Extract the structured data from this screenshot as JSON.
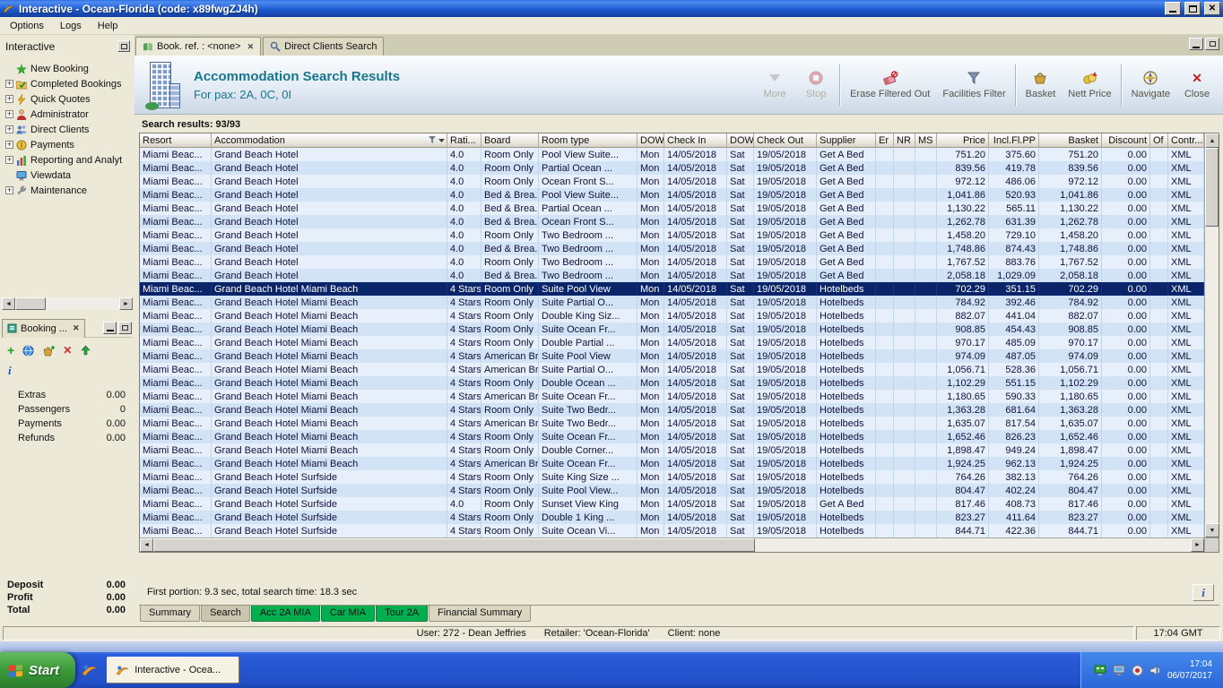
{
  "window": {
    "title": "Interactive - Ocean-Florida (code: x89fwgZJ4h)",
    "menu": [
      "Options",
      "Logs",
      "Help"
    ]
  },
  "sidebar": {
    "title": "Interactive",
    "items": [
      {
        "label": "New Booking",
        "expand": false
      },
      {
        "label": "Completed Bookings",
        "expand": true
      },
      {
        "label": "Quick Quotes",
        "expand": true
      },
      {
        "label": "Administrator",
        "expand": true
      },
      {
        "label": "Direct Clients",
        "expand": true
      },
      {
        "label": "Payments",
        "expand": true
      },
      {
        "label": "Reporting and Analyt",
        "expand": true
      },
      {
        "label": "Viewdata",
        "expand": false
      },
      {
        "label": "Maintenance",
        "expand": true
      }
    ]
  },
  "booking_panel": {
    "title": "Booking ...",
    "fields": [
      {
        "label": "Extras",
        "value": "0.00"
      },
      {
        "label": "Passengers",
        "value": "0"
      },
      {
        "label": "Payments",
        "value": "0.00"
      },
      {
        "label": "Refunds",
        "value": "0.00"
      }
    ],
    "totals": [
      {
        "label": "Deposit",
        "value": "0.00"
      },
      {
        "label": "Profit",
        "value": "0.00"
      },
      {
        "label": "Total",
        "value": "0.00"
      }
    ]
  },
  "tabs": [
    {
      "label": "Book. ref. : <none>"
    },
    {
      "label": "Direct Clients Search"
    }
  ],
  "header": {
    "title": "Accommodation Search Results",
    "subtitle": "For pax: 2A, 0C, 0I"
  },
  "toolbar": [
    {
      "label": "More",
      "disabled": true
    },
    {
      "label": "Stop",
      "disabled": true
    },
    {
      "label": "Erase Filtered Out"
    },
    {
      "label": "Facilities Filter"
    },
    {
      "label": "Basket"
    },
    {
      "label": "Nett Price"
    },
    {
      "label": "Navigate"
    },
    {
      "label": "Close"
    }
  ],
  "results": {
    "label": "Search results: 93/93",
    "columns": [
      "Resort",
      "Accommodation",
      "Rati...",
      "Board",
      "Room type",
      "DOW",
      "Check In",
      "DOW",
      "Check Out",
      "Supplier",
      "Er",
      "NR",
      "MS",
      "Price",
      "Incl.Fl.PP",
      "Basket",
      "Discount",
      "Of",
      "Contr..."
    ],
    "rows": [
      {
        "resort": "Miami Beac...",
        "acc": "Grand Beach Hotel",
        "rating": "4.0",
        "board": "Room Only",
        "room": "Pool View Suite...",
        "dow1": "Mon",
        "checkin": "14/05/2018",
        "dow2": "Sat",
        "checkout": "19/05/2018",
        "supplier": "Get A Bed",
        "price": "751.20",
        "incl": "375.60",
        "basket": "751.20",
        "discount": "0.00",
        "contract": "XML"
      },
      {
        "resort": "Miami Beac...",
        "acc": "Grand Beach Hotel",
        "rating": "4.0",
        "board": "Room Only",
        "room": "Partial Ocean ...",
        "dow1": "Mon",
        "checkin": "14/05/2018",
        "dow2": "Sat",
        "checkout": "19/05/2018",
        "supplier": "Get A Bed",
        "price": "839.56",
        "incl": "419.78",
        "basket": "839.56",
        "discount": "0.00",
        "contract": "XML"
      },
      {
        "resort": "Miami Beac...",
        "acc": "Grand Beach Hotel",
        "rating": "4.0",
        "board": "Room Only",
        "room": "Ocean Front S...",
        "dow1": "Mon",
        "checkin": "14/05/2018",
        "dow2": "Sat",
        "checkout": "19/05/2018",
        "supplier": "Get A Bed",
        "price": "972.12",
        "incl": "486.06",
        "basket": "972.12",
        "discount": "0.00",
        "contract": "XML"
      },
      {
        "resort": "Miami Beac...",
        "acc": "Grand Beach Hotel",
        "rating": "4.0",
        "board": "Bed & Brea...",
        "room": "Pool View Suite...",
        "dow1": "Mon",
        "checkin": "14/05/2018",
        "dow2": "Sat",
        "checkout": "19/05/2018",
        "supplier": "Get A Bed",
        "price": "1,041.86",
        "incl": "520.93",
        "basket": "1,041.86",
        "discount": "0.00",
        "contract": "XML"
      },
      {
        "resort": "Miami Beac...",
        "acc": "Grand Beach Hotel",
        "rating": "4.0",
        "board": "Bed & Brea...",
        "room": "Partial Ocean ...",
        "dow1": "Mon",
        "checkin": "14/05/2018",
        "dow2": "Sat",
        "checkout": "19/05/2018",
        "supplier": "Get A Bed",
        "price": "1,130.22",
        "incl": "565.11",
        "basket": "1,130.22",
        "discount": "0.00",
        "contract": "XML"
      },
      {
        "resort": "Miami Beac...",
        "acc": "Grand Beach Hotel",
        "rating": "4.0",
        "board": "Bed & Brea...",
        "room": "Ocean Front S...",
        "dow1": "Mon",
        "checkin": "14/05/2018",
        "dow2": "Sat",
        "checkout": "19/05/2018",
        "supplier": "Get A Bed",
        "price": "1,262.78",
        "incl": "631.39",
        "basket": "1,262.78",
        "discount": "0.00",
        "contract": "XML"
      },
      {
        "resort": "Miami Beac...",
        "acc": "Grand Beach Hotel",
        "rating": "4.0",
        "board": "Room Only",
        "room": "Two Bedroom ...",
        "dow1": "Mon",
        "checkin": "14/05/2018",
        "dow2": "Sat",
        "checkout": "19/05/2018",
        "supplier": "Get A Bed",
        "price": "1,458.20",
        "incl": "729.10",
        "basket": "1,458.20",
        "discount": "0.00",
        "contract": "XML"
      },
      {
        "resort": "Miami Beac...",
        "acc": "Grand Beach Hotel",
        "rating": "4.0",
        "board": "Bed & Brea...",
        "room": "Two Bedroom ...",
        "dow1": "Mon",
        "checkin": "14/05/2018",
        "dow2": "Sat",
        "checkout": "19/05/2018",
        "supplier": "Get A Bed",
        "price": "1,748.86",
        "incl": "874.43",
        "basket": "1,748.86",
        "discount": "0.00",
        "contract": "XML"
      },
      {
        "resort": "Miami Beac...",
        "acc": "Grand Beach Hotel",
        "rating": "4.0",
        "board": "Room Only",
        "room": "Two Bedroom ...",
        "dow1": "Mon",
        "checkin": "14/05/2018",
        "dow2": "Sat",
        "checkout": "19/05/2018",
        "supplier": "Get A Bed",
        "price": "1,767.52",
        "incl": "883.76",
        "basket": "1,767.52",
        "discount": "0.00",
        "contract": "XML"
      },
      {
        "resort": "Miami Beac...",
        "acc": "Grand Beach Hotel",
        "rating": "4.0",
        "board": "Bed & Brea...",
        "room": "Two Bedroom ...",
        "dow1": "Mon",
        "checkin": "14/05/2018",
        "dow2": "Sat",
        "checkout": "19/05/2018",
        "supplier": "Get A Bed",
        "price": "2,058.18",
        "incl": "1,029.09",
        "basket": "2,058.18",
        "discount": "0.00",
        "contract": "XML"
      },
      {
        "resort": "Miami Beac...",
        "acc": "Grand Beach Hotel Miami Beach",
        "rating": "4 Stars",
        "board": "Room Only",
        "room": "Suite Pool View",
        "dow1": "Mon",
        "checkin": "14/05/2018",
        "dow2": "Sat",
        "checkout": "19/05/2018",
        "supplier": "Hotelbeds",
        "price": "702.29",
        "incl": "351.15",
        "basket": "702.29",
        "discount": "0.00",
        "contract": "XML",
        "selected": true
      },
      {
        "resort": "Miami Beac...",
        "acc": "Grand Beach Hotel Miami Beach",
        "rating": "4 Stars",
        "board": "Room Only",
        "room": "Suite Partial O...",
        "dow1": "Mon",
        "checkin": "14/05/2018",
        "dow2": "Sat",
        "checkout": "19/05/2018",
        "supplier": "Hotelbeds",
        "price": "784.92",
        "incl": "392.46",
        "basket": "784.92",
        "discount": "0.00",
        "contract": "XML"
      },
      {
        "resort": "Miami Beac...",
        "acc": "Grand Beach Hotel Miami Beach",
        "rating": "4 Stars",
        "board": "Room Only",
        "room": "Double King Siz...",
        "dow1": "Mon",
        "checkin": "14/05/2018",
        "dow2": "Sat",
        "checkout": "19/05/2018",
        "supplier": "Hotelbeds",
        "price": "882.07",
        "incl": "441.04",
        "basket": "882.07",
        "discount": "0.00",
        "contract": "XML"
      },
      {
        "resort": "Miami Beac...",
        "acc": "Grand Beach Hotel Miami Beach",
        "rating": "4 Stars",
        "board": "Room Only",
        "room": "Suite Ocean Fr...",
        "dow1": "Mon",
        "checkin": "14/05/2018",
        "dow2": "Sat",
        "checkout": "19/05/2018",
        "supplier": "Hotelbeds",
        "price": "908.85",
        "incl": "454.43",
        "basket": "908.85",
        "discount": "0.00",
        "contract": "XML"
      },
      {
        "resort": "Miami Beac...",
        "acc": "Grand Beach Hotel Miami Beach",
        "rating": "4 Stars",
        "board": "Room Only",
        "room": "Double Partial ...",
        "dow1": "Mon",
        "checkin": "14/05/2018",
        "dow2": "Sat",
        "checkout": "19/05/2018",
        "supplier": "Hotelbeds",
        "price": "970.17",
        "incl": "485.09",
        "basket": "970.17",
        "discount": "0.00",
        "contract": "XML"
      },
      {
        "resort": "Miami Beac...",
        "acc": "Grand Beach Hotel Miami Beach",
        "rating": "4 Stars",
        "board": "American Br...",
        "room": "Suite Pool View",
        "dow1": "Mon",
        "checkin": "14/05/2018",
        "dow2": "Sat",
        "checkout": "19/05/2018",
        "supplier": "Hotelbeds",
        "price": "974.09",
        "incl": "487.05",
        "basket": "974.09",
        "discount": "0.00",
        "contract": "XML"
      },
      {
        "resort": "Miami Beac...",
        "acc": "Grand Beach Hotel Miami Beach",
        "rating": "4 Stars",
        "board": "American Br...",
        "room": "Suite Partial O...",
        "dow1": "Mon",
        "checkin": "14/05/2018",
        "dow2": "Sat",
        "checkout": "19/05/2018",
        "supplier": "Hotelbeds",
        "price": "1,056.71",
        "incl": "528.36",
        "basket": "1,056.71",
        "discount": "0.00",
        "contract": "XML"
      },
      {
        "resort": "Miami Beac...",
        "acc": "Grand Beach Hotel Miami Beach",
        "rating": "4 Stars",
        "board": "Room Only",
        "room": "Double Ocean ...",
        "dow1": "Mon",
        "checkin": "14/05/2018",
        "dow2": "Sat",
        "checkout": "19/05/2018",
        "supplier": "Hotelbeds",
        "price": "1,102.29",
        "incl": "551.15",
        "basket": "1,102.29",
        "discount": "0.00",
        "contract": "XML"
      },
      {
        "resort": "Miami Beac...",
        "acc": "Grand Beach Hotel Miami Beach",
        "rating": "4 Stars",
        "board": "American Br...",
        "room": "Suite Ocean Fr...",
        "dow1": "Mon",
        "checkin": "14/05/2018",
        "dow2": "Sat",
        "checkout": "19/05/2018",
        "supplier": "Hotelbeds",
        "price": "1,180.65",
        "incl": "590.33",
        "basket": "1,180.65",
        "discount": "0.00",
        "contract": "XML"
      },
      {
        "resort": "Miami Beac...",
        "acc": "Grand Beach Hotel Miami Beach",
        "rating": "4 Stars",
        "board": "Room Only",
        "room": "Suite Two Bedr...",
        "dow1": "Mon",
        "checkin": "14/05/2018",
        "dow2": "Sat",
        "checkout": "19/05/2018",
        "supplier": "Hotelbeds",
        "price": "1,363.28",
        "incl": "681.64",
        "basket": "1,363.28",
        "discount": "0.00",
        "contract": "XML"
      },
      {
        "resort": "Miami Beac...",
        "acc": "Grand Beach Hotel Miami Beach",
        "rating": "4 Stars",
        "board": "American Br...",
        "room": "Suite Two Bedr...",
        "dow1": "Mon",
        "checkin": "14/05/2018",
        "dow2": "Sat",
        "checkout": "19/05/2018",
        "supplier": "Hotelbeds",
        "price": "1,635.07",
        "incl": "817.54",
        "basket": "1,635.07",
        "discount": "0.00",
        "contract": "XML"
      },
      {
        "resort": "Miami Beac...",
        "acc": "Grand Beach Hotel Miami Beach",
        "rating": "4 Stars",
        "board": "Room Only",
        "room": "Suite Ocean Fr...",
        "dow1": "Mon",
        "checkin": "14/05/2018",
        "dow2": "Sat",
        "checkout": "19/05/2018",
        "supplier": "Hotelbeds",
        "price": "1,652.46",
        "incl": "826.23",
        "basket": "1,652.46",
        "discount": "0.00",
        "contract": "XML"
      },
      {
        "resort": "Miami Beac...",
        "acc": "Grand Beach Hotel Miami Beach",
        "rating": "4 Stars",
        "board": "Room Only",
        "room": "Double Corner...",
        "dow1": "Mon",
        "checkin": "14/05/2018",
        "dow2": "Sat",
        "checkout": "19/05/2018",
        "supplier": "Hotelbeds",
        "price": "1,898.47",
        "incl": "949.24",
        "basket": "1,898.47",
        "discount": "0.00",
        "contract": "XML"
      },
      {
        "resort": "Miami Beac...",
        "acc": "Grand Beach Hotel Miami Beach",
        "rating": "4 Stars",
        "board": "American Br...",
        "room": "Suite Ocean Fr...",
        "dow1": "Mon",
        "checkin": "14/05/2018",
        "dow2": "Sat",
        "checkout": "19/05/2018",
        "supplier": "Hotelbeds",
        "price": "1,924.25",
        "incl": "962.13",
        "basket": "1,924.25",
        "discount": "0.00",
        "contract": "XML"
      },
      {
        "resort": "Miami Beac...",
        "acc": "Grand Beach Hotel Surfside",
        "rating": "4 Stars",
        "board": "Room Only",
        "room": "Suite King Size ...",
        "dow1": "Mon",
        "checkin": "14/05/2018",
        "dow2": "Sat",
        "checkout": "19/05/2018",
        "supplier": "Hotelbeds",
        "price": "764.26",
        "incl": "382.13",
        "basket": "764.26",
        "discount": "0.00",
        "contract": "XML"
      },
      {
        "resort": "Miami Beac...",
        "acc": "Grand Beach Hotel Surfside",
        "rating": "4 Stars",
        "board": "Room Only",
        "room": "Suite Pool View...",
        "dow1": "Mon",
        "checkin": "14/05/2018",
        "dow2": "Sat",
        "checkout": "19/05/2018",
        "supplier": "Hotelbeds",
        "price": "804.47",
        "incl": "402.24",
        "basket": "804.47",
        "discount": "0.00",
        "contract": "XML"
      },
      {
        "resort": "Miami Beac...",
        "acc": "Grand Beach Hotel Surfside",
        "rating": "4.0",
        "board": "Room Only",
        "room": "Sunset View King",
        "dow1": "Mon",
        "checkin": "14/05/2018",
        "dow2": "Sat",
        "checkout": "19/05/2018",
        "supplier": "Get A Bed",
        "price": "817.46",
        "incl": "408.73",
        "basket": "817.46",
        "discount": "0.00",
        "contract": "XML"
      },
      {
        "resort": "Miami Beac...",
        "acc": "Grand Beach Hotel Surfside",
        "rating": "4 Stars",
        "board": "Room Only",
        "room": "Double 1 King ...",
        "dow1": "Mon",
        "checkin": "14/05/2018",
        "dow2": "Sat",
        "checkout": "19/05/2018",
        "supplier": "Hotelbeds",
        "price": "823.27",
        "incl": "411.64",
        "basket": "823.27",
        "discount": "0.00",
        "contract": "XML"
      },
      {
        "resort": "Miami Beac...",
        "acc": "Grand Beach Hotel Surfside",
        "rating": "4 Stars",
        "board": "Room Only",
        "room": "Suite Ocean Vi...",
        "dow1": "Mon",
        "checkin": "14/05/2018",
        "dow2": "Sat",
        "checkout": "19/05/2018",
        "supplier": "Hotelbeds",
        "price": "844.71",
        "incl": "422.36",
        "basket": "844.71",
        "discount": "0.00",
        "contract": "XML"
      }
    ]
  },
  "footer": {
    "status": "First portion: 9.3 sec, total search time: 18.3 sec",
    "tabs": [
      {
        "label": "Summary"
      },
      {
        "label": "Search",
        "variant": "pressed"
      },
      {
        "label": "Acc 2A MIA",
        "variant": "green"
      },
      {
        "label": "Car MIA",
        "variant": "green"
      },
      {
        "label": "Tour 2A",
        "variant": "green"
      },
      {
        "label": "Financial Summary"
      }
    ]
  },
  "statusbar": {
    "user": "User: 272 - Dean Jeffries",
    "retailer": "Retailer: 'Ocean-Florida'",
    "client": "Client: none",
    "time": "17:04 GMT"
  },
  "taskbar": {
    "start": "Start",
    "task": "Interactive - Ocea...",
    "tray_time": "17:04",
    "tray_date": "06/07/2017"
  }
}
